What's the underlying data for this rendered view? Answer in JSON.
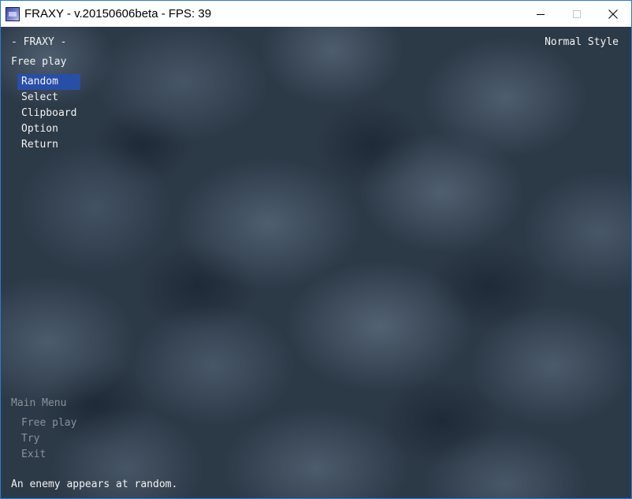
{
  "window": {
    "title": "FRAXY - v.20150606beta - FPS: 39",
    "icon": "fraxy-app-icon",
    "controls": [
      "minimize-icon",
      "maximize-icon",
      "close-icon"
    ]
  },
  "header": {
    "game_title": "- FRAXY -",
    "style_label": "Normal Style"
  },
  "submenu": {
    "title": "Free play",
    "selected_index": 0,
    "items": [
      {
        "label": "Random"
      },
      {
        "label": "Select"
      },
      {
        "label": "Clipboard"
      },
      {
        "label": "Option"
      },
      {
        "label": "Return"
      }
    ]
  },
  "main_menu": {
    "title": "Main Menu",
    "items": [
      {
        "label": "Free play"
      },
      {
        "label": "Try"
      },
      {
        "label": "Exit"
      }
    ]
  },
  "status": {
    "description": "An enemy appears at random."
  },
  "colors": {
    "highlight": "#284ea8",
    "text": "#f2f2f2",
    "dim_text": "#8a929b",
    "window_border": "#2b7bd6"
  }
}
